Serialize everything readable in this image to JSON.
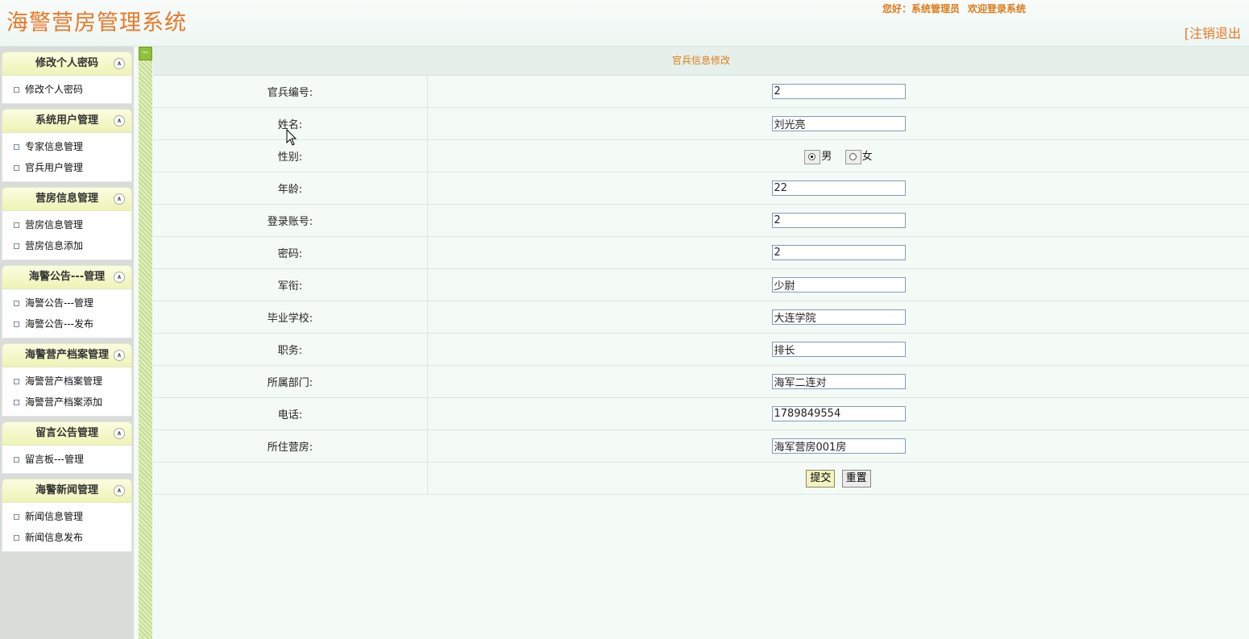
{
  "header": {
    "title": "海警营房管理系统",
    "greeting_prefix": "您好：系统管理员",
    "greeting_welcome": "欢迎登录系统",
    "logout_label": "[注销退出"
  },
  "sidebar": {
    "groups": [
      {
        "title": "修改个人密码",
        "items": [
          "修改个人密码"
        ]
      },
      {
        "title": "系统用户管理",
        "items": [
          "专家信息管理",
          "官兵用户管理"
        ]
      },
      {
        "title": "营房信息管理",
        "items": [
          "营房信息管理",
          "营房信息添加"
        ]
      },
      {
        "title": "海警公告---管理",
        "items": [
          "海警公告---管理",
          "海警公告---发布"
        ]
      },
      {
        "title": "海警营产档案管理",
        "items": [
          "海警营产档案管理",
          "海警营产档案添加"
        ]
      },
      {
        "title": "留言公告管理",
        "items": [
          "留言板---管理"
        ]
      },
      {
        "title": "海警新闻管理",
        "items": [
          "新闻信息管理",
          "新闻信息发布"
        ]
      }
    ]
  },
  "form": {
    "caption": "官兵信息修改",
    "fields": {
      "number": {
        "label": "官兵编号:",
        "value": "2"
      },
      "name": {
        "label": "姓名:",
        "value": "刘光亮"
      },
      "gender": {
        "label": "性别:",
        "option_male": "男",
        "option_female": "女",
        "selected": "男"
      },
      "age": {
        "label": "年龄:",
        "value": "22"
      },
      "account": {
        "label": "登录账号:",
        "value": "2"
      },
      "password": {
        "label": "密码:",
        "value": "2"
      },
      "rank": {
        "label": "军衔:",
        "value": "少尉"
      },
      "school": {
        "label": "毕业学校:",
        "value": "大连学院"
      },
      "position": {
        "label": "职务:",
        "value": "排长"
      },
      "department": {
        "label": "所属部门:",
        "value": "海军二连对"
      },
      "phone": {
        "label": "电话:",
        "value": "1789849554"
      },
      "barracks": {
        "label": "所住营房:",
        "value": "海军营房001房"
      }
    },
    "submit_label": "提交",
    "reset_label": "重置"
  },
  "colors": {
    "accent": "#e8782a",
    "menu_header": "#eef3b5",
    "splitter": "#c4dc8e"
  }
}
